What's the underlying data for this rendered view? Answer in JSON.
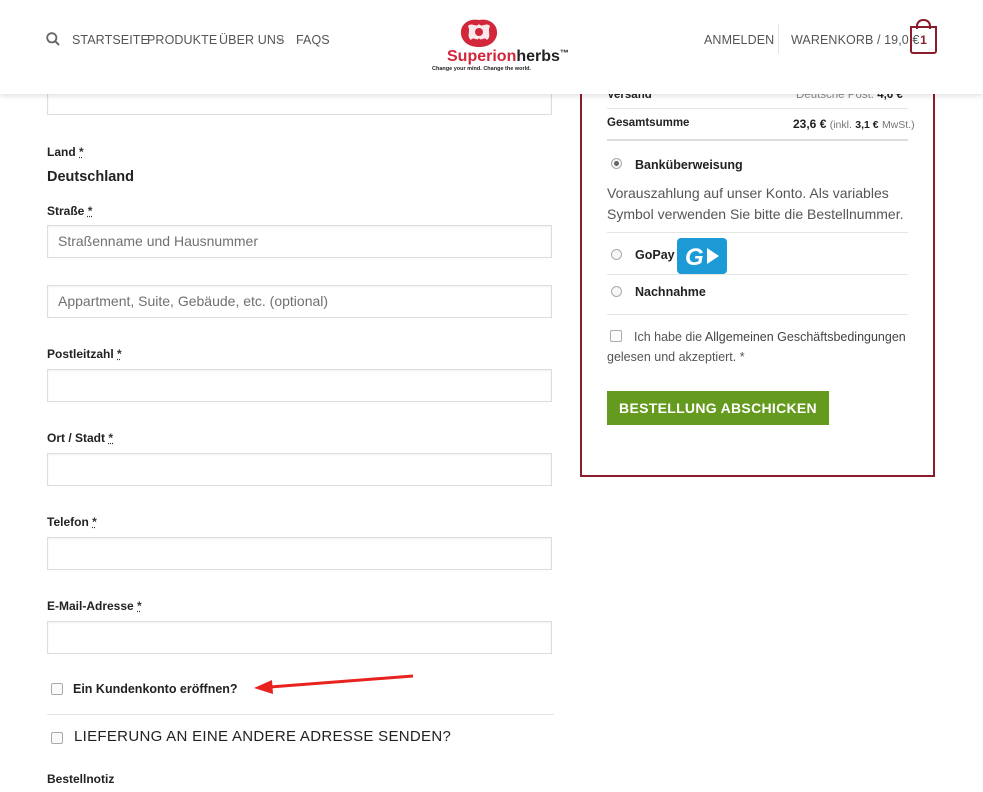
{
  "header": {
    "nav": [
      "STARTSEITE",
      "PRODUKTE",
      "ÜBER UNS",
      "FAQS"
    ],
    "logo_text_a": "Superion",
    "logo_text_b": "herbs",
    "logo_tm": "™",
    "logo_tagline": "Change your mind. Change the world.",
    "login": "ANMELDEN",
    "cart": "WARENKORB / 19,0 €",
    "cart_count": "1"
  },
  "form": {
    "country_label": "Land",
    "country_value": "Deutschland",
    "street_label": "Straße",
    "street_placeholder": "Straßenname und Hausnummer",
    "street2_placeholder": "Appartment, Suite, Gebäude, etc. (optional)",
    "zip_label": "Postleitzahl",
    "city_label": "Ort / Stadt",
    "phone_label": "Telefon",
    "email_label": "E-Mail-Adresse",
    "required_mark": "*",
    "create_account": "Ein Kundenkonto eröffnen?",
    "ship_different": "LIEFERUNG AN EINE ANDERE ADRESSE SENDEN?",
    "order_notes_label": "Bestellnotiz"
  },
  "order": {
    "shipping_label": "Versand",
    "shipping_method": "Deutsche Post:",
    "shipping_cost": "4,6 €",
    "total_label": "Gesamtsumme",
    "total_value": "23,6 €",
    "total_tax_pre": "(inkl.",
    "total_tax_value": "3,1 €",
    "total_tax_post": "MwSt.)",
    "payment_bank": "Banküberweisung",
    "payment_bank_desc_1": "Vorauszahlung auf unser Konto. Als variables",
    "payment_bank_desc_2": "Symbol verwenden Sie bitte die Bestellnummer.",
    "payment_gopay": "GoPay",
    "payment_cod": "Nachnahme",
    "terms_1_pre": "Ich habe die",
    "terms_link": "Allgemeinen Geschäftsbedingungen",
    "terms_2": "gelesen und akzeptiert.",
    "terms_req": "*",
    "submit": "BESTELLUNG ABSCHICKEN"
  },
  "colors": {
    "brand": "#8a1c2b",
    "submit_green": "#649a1d",
    "gopay_blue": "#1b9ad6",
    "annotation_arrow": "#e8221f"
  }
}
